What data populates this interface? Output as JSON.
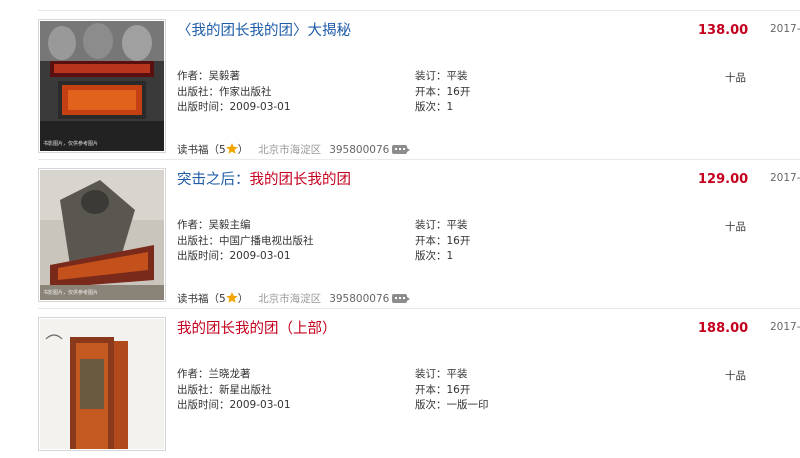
{
  "results": [
    {
      "title_parts": [
        {
          "text": "〈我的团长我的团〉",
          "color": "blue"
        },
        {
          "text": "大揭秘",
          "color": "blue"
        }
      ],
      "author": "作者：吴毅著",
      "publisher": "出版社：作家出版社",
      "pub_date": "出版时间：2009-03-01",
      "binding": "装订：平装",
      "format": "开本：16开",
      "edition": "版次：1",
      "shop_prefix": "读书福（5",
      "shop_suffix": "）",
      "location": "北京市海淀区",
      "qq": "395800076",
      "price": "138.00",
      "quality": "十品",
      "listed_date": "2017-",
      "cover_caption": "书影图片，仅供参考图片",
      "cover_style": "dark"
    },
    {
      "title_parts": [
        {
          "text": "突击之后：",
          "color": "blue"
        },
        {
          "text": "我的团长我的团",
          "color": "red"
        }
      ],
      "author": "作者：吴毅主编",
      "publisher": "出版社：中国广播电视出版社",
      "pub_date": "出版时间：2009-03-01",
      "binding": "装订：平装",
      "format": "开本：16开",
      "edition": "版次：1",
      "shop_prefix": "读书福（5",
      "shop_suffix": "）",
      "location": "北京市海淀区",
      "qq": "395800076",
      "price": "129.00",
      "quality": "十品",
      "listed_date": "2017-",
      "cover_caption": "书影图片，仅供参考图片",
      "cover_style": "grey"
    },
    {
      "title_parts": [
        {
          "text": "我的团长我的团（上部）",
          "color": "red"
        }
      ],
      "author": "作者：兰晓龙著",
      "publisher": "出版社：新星出版社",
      "pub_date": "出版时间：2009-03-01",
      "binding": "装订：平装",
      "format": "开本：16开",
      "edition": "版次：一版一印",
      "shop_prefix": "",
      "shop_suffix": "",
      "location": "",
      "qq": "",
      "price": "188.00",
      "quality": "十品",
      "listed_date": "2017-",
      "cover_caption": "",
      "cover_style": "box"
    }
  ],
  "colors": {
    "title_blue": "#1f5ca8",
    "title_red": "#c4001e",
    "price": "#c4001e",
    "star": "#f2a400",
    "border": "#e9e9e9"
  }
}
